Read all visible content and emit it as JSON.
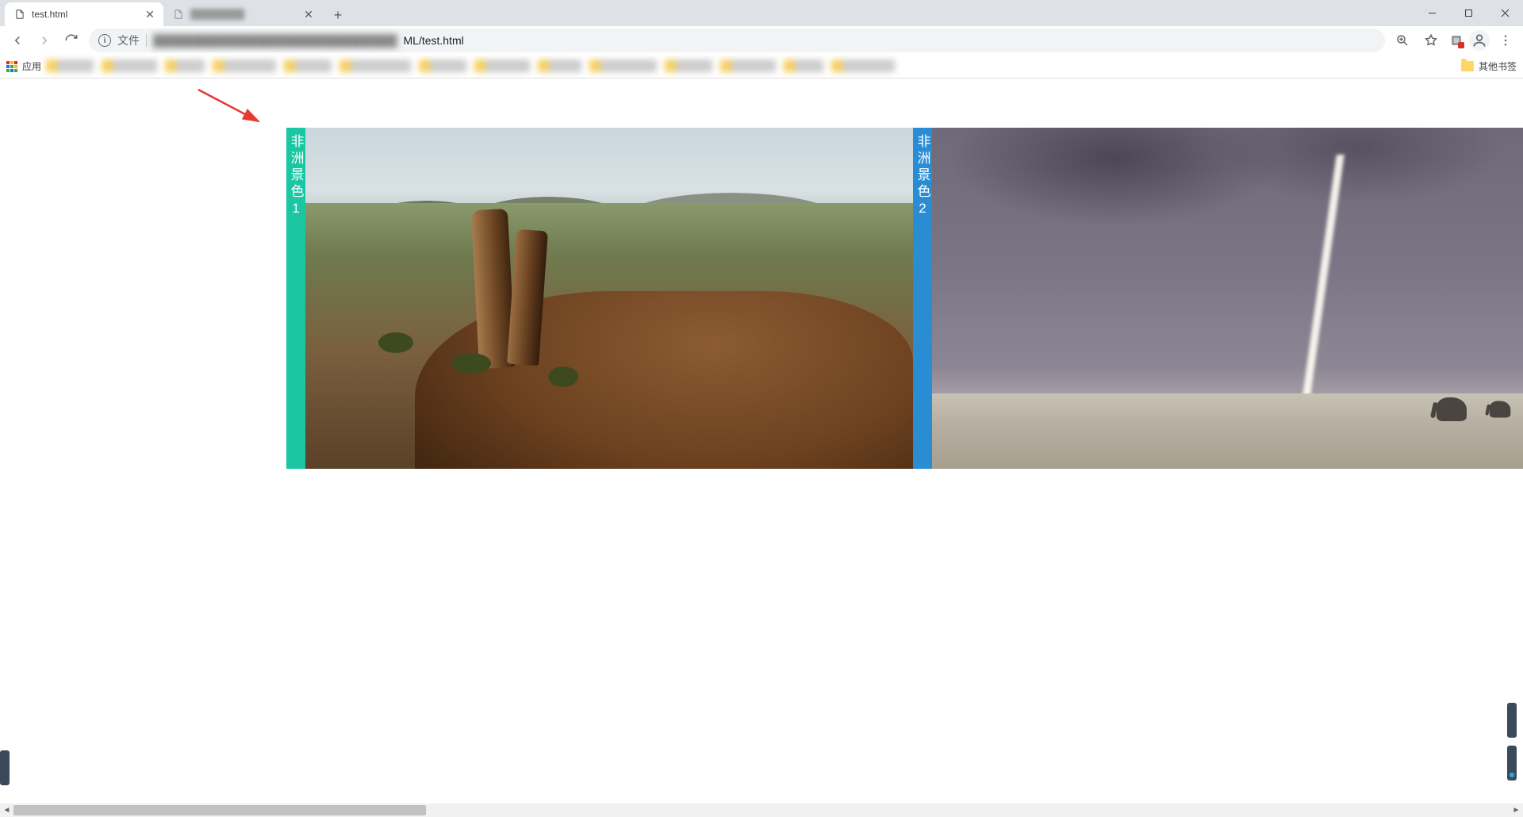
{
  "browser": {
    "tabs": [
      {
        "title": "test.html",
        "active": true
      },
      {
        "title": "blurred",
        "active": false
      }
    ],
    "apps_label": "应用",
    "other_bookmarks": "其他书签",
    "omnibox": {
      "file_label": "文件",
      "visible_url_suffix": "ML/test.html"
    }
  },
  "page": {
    "slides": [
      {
        "tag": "非洲景色1",
        "tag_color": "green"
      },
      {
        "tag": "非洲景色2",
        "tag_color": "blue"
      }
    ]
  }
}
